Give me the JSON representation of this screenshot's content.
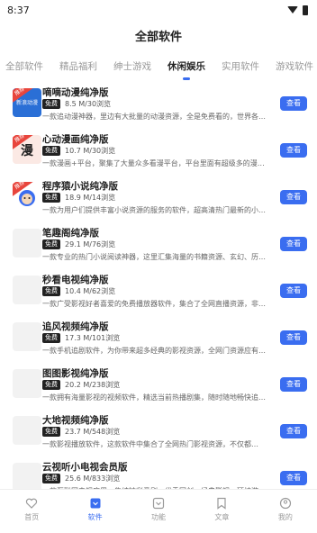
{
  "status_bar": {
    "time": "8:37"
  },
  "page_title": "全部软件",
  "tabs": [
    "全部软件",
    "精品福利",
    "绅士游戏",
    "休闲娱乐",
    "实用软件",
    "游戏软件"
  ],
  "active_tab_index": 3,
  "list": [
    {
      "name": "嘀嘀动漫纯净版",
      "badge": "免费",
      "meta": "8.5 M/30浏览",
      "desc": "一款追动漫神器，里边有大批量的动漫资源，全是免费看的，世界各…",
      "button": "查看",
      "ribbon": "推荐",
      "thumb_text": "新浪动漫"
    },
    {
      "name": "心动漫画纯净版",
      "badge": "免费",
      "meta": "10.7 M/30浏览",
      "desc": "一款漫画+平台，聚集了大量众多看漫平台，平台里面有超级多的漫画资源提…",
      "button": "查看",
      "ribbon": "推荐",
      "thumb_text": "漫"
    },
    {
      "name": "程序猿小说纯净版",
      "badge": "免费",
      "meta": "18.9 M/14浏览",
      "desc": "一款为用户们提供丰富小说资源的服务的软件，超高清热门最新的小说…",
      "button": "查看",
      "ribbon": "推荐",
      "thumb_text": ""
    },
    {
      "name": "笔趣阁纯净版",
      "badge": "免费",
      "meta": "29.1 M/76浏览",
      "desc": "一款专业的热门小说阅读神器，这里汇集海量的书籍资源、玄幻、历史…",
      "button": "查看",
      "ribbon": "",
      "thumb_text": ""
    },
    {
      "name": "秒看电视纯净版",
      "badge": "免费",
      "meta": "10.4 M/62浏览",
      "desc": "一款广受影视好者喜爱的免费播放器软件，集合了全网直播资源，非常全…",
      "button": "查看",
      "ribbon": "",
      "thumb_text": ""
    },
    {
      "name": "追风视频纯净版",
      "badge": "免费",
      "meta": "17.3 M/101浏览",
      "desc": "一款手机追剧软件，为你带来超多经典的影视资源，全网门资源应有尽…",
      "button": "查看",
      "ribbon": "",
      "thumb_text": ""
    },
    {
      "name": "图图影视纯净版",
      "badge": "免费",
      "meta": "20.2 M/238浏览",
      "desc": "一款拥有海量影视的视频软件，精选当前热播剧集，随时随地畅快追剧…",
      "button": "查看",
      "ribbon": "",
      "thumb_text": ""
    },
    {
      "name": "大地视频纯净版",
      "badge": "免费",
      "meta": "23.7 M/548浏览",
      "desc": "一款影视播放软件，这款软件中集合了全网热门影视资源，不仅都…",
      "button": "查看",
      "ribbon": "",
      "thumb_text": ""
    },
    {
      "name": "云视听小电视会员版",
      "badge": "免费",
      "meta": "25.6 M/833浏览",
      "desc": "一款互联网电视应用，集结精彩番剧、优秀国创、经典影视、硬核游戏…",
      "button": "查看",
      "ribbon": "",
      "thumb_text": ""
    }
  ],
  "tab_bar": [
    {
      "label": "首页",
      "icon": "heart-icon"
    },
    {
      "label": "软件",
      "icon": "software-icon"
    },
    {
      "label": "功能",
      "icon": "function-icon"
    },
    {
      "label": "文章",
      "icon": "article-icon"
    },
    {
      "label": "我的",
      "icon": "user-icon"
    }
  ],
  "tab_bar_active_index": 1,
  "colors": {
    "accent": "#3a6df0",
    "ribbon": "#e8453c",
    "badge": "#222222"
  }
}
